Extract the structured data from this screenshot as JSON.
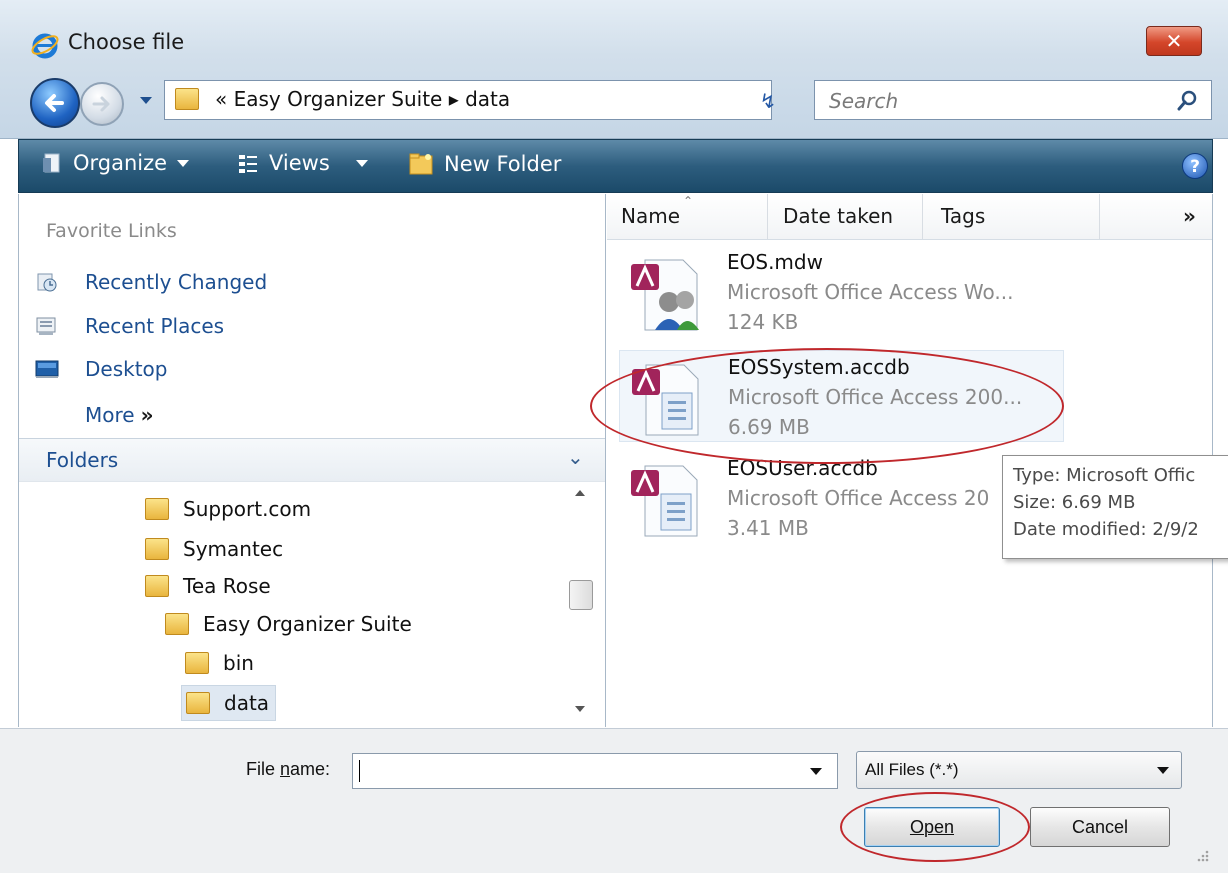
{
  "window": {
    "title": "Choose file",
    "close_label": "✕"
  },
  "address": {
    "path": "«  Easy Organizer Suite  ▸  data",
    "search_placeholder": "Search"
  },
  "toolbar": {
    "organize": "Organize",
    "views": "Views",
    "new_folder": "New Folder",
    "help": "?"
  },
  "favorites": {
    "heading": "Favorite Links",
    "items": [
      {
        "label": "Recently Changed",
        "icon": "recently-changed-icon"
      },
      {
        "label": "Recent Places",
        "icon": "recent-places-icon"
      },
      {
        "label": "Desktop",
        "icon": "desktop-icon"
      }
    ],
    "more_label": "More",
    "more_chevron": "»"
  },
  "folders": {
    "label": "Folders",
    "tree": [
      {
        "label": "Support.com"
      },
      {
        "label": "Symantec"
      },
      {
        "label": "Tea Rose"
      },
      {
        "label": "Easy Organizer Suite"
      },
      {
        "label": "bin"
      },
      {
        "label": "data",
        "selected": true
      }
    ]
  },
  "columns": {
    "name": "Name",
    "date_taken": "Date taken",
    "tags": "Tags",
    "more": "»"
  },
  "files": [
    {
      "name": "EOS.mdw",
      "type": "Microsoft Office Access Wo...",
      "size": "124 KB",
      "icon": "access-workgroup-icon"
    },
    {
      "name": "EOSSystem.accdb",
      "type": "Microsoft Office Access 200...",
      "size": "6.69 MB",
      "icon": "access-database-icon"
    },
    {
      "name": "EOSUser.accdb",
      "type": "Microsoft Office Access 20",
      "size": "3.41 MB",
      "icon": "access-database-icon"
    }
  ],
  "tooltip": {
    "type": "Type: Microsoft Offic",
    "size": "Size: 6.69 MB",
    "modified": "Date modified: 2/9/2"
  },
  "bottom": {
    "file_name_label_pre": "File ",
    "file_name_label_accel": "n",
    "file_name_label_post": "ame:",
    "file_name_value": "",
    "filter": "All Files (*.*)",
    "open_label": "Open",
    "cancel_label": "Cancel"
  },
  "colors": {
    "annotation": "#c0282c",
    "toolbar": "#2d5d7e",
    "link": "#1d4f91"
  }
}
